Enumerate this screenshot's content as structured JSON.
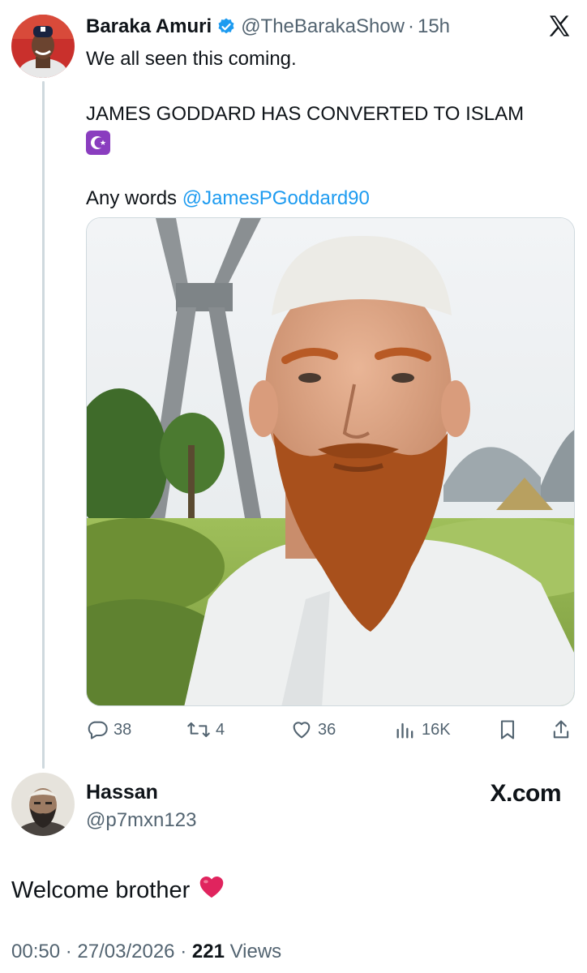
{
  "tweet": {
    "author_name": "Baraka Amuri",
    "author_handle": "@TheBarakaShow",
    "separator": "·",
    "time_ago": "15h",
    "line1": "We all seen this coming.",
    "line2": "JAMES GODDARD HAS CONVERTED TO ISLAM",
    "line2_emoji": "star-and-crescent-emoji",
    "line3_prefix": "Any words ",
    "line3_mention": "@JamesPGoddard90",
    "image_alt": "photo",
    "actions": {
      "replies": "38",
      "reposts": "4",
      "likes": "36",
      "views": "16K"
    }
  },
  "reply": {
    "author_name": "Hassan",
    "author_handle": "@p7mxn123",
    "brand": "X.com",
    "text": "Welcome brother",
    "emoji": "red-heart-emoji",
    "time": "00:50",
    "date": "27/03/2026",
    "views_count": "221",
    "views_label": "Views"
  },
  "colors": {
    "link": "#1d9bf0",
    "secondary_text": "#536471",
    "thread_line": "#cfd9de",
    "verified": "#1d9bf0",
    "heart": "#e0245e"
  }
}
